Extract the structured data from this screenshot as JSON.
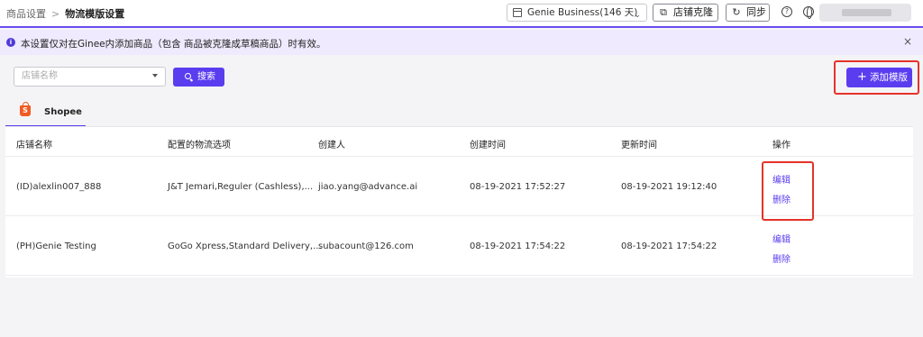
{
  "breadcrumb": {
    "parent": "商品设置",
    "separator": ">",
    "current": "物流模版设置"
  },
  "header": {
    "store_select": "Genie Business(146 天)",
    "clone_button": "店铺克隆",
    "sync_button": "同步",
    "help_icon": "question-circle-icon",
    "language_icon": "globe-icon"
  },
  "notice": {
    "text": "本设置仅对在Ginee内添加商品（包含 商品被克隆成草稿商品）时有效。",
    "icon": "info-icon",
    "close": "×"
  },
  "filters": {
    "shop_placeholder": "店铺名称",
    "search_button": "搜索"
  },
  "add_template_button": "添加模版",
  "tabs": [
    {
      "label": "Shopee",
      "icon": "shopee-bag-icon"
    }
  ],
  "table": {
    "headers": [
      "店铺名称",
      "配置的物流选项",
      "创建人",
      "创建时间",
      "更新时间",
      "操作"
    ],
    "rows": [
      {
        "shop": "(ID)alexlin007_888",
        "logistics": "J&T Jemari,Reguler (Cashless),...",
        "creator": "jiao.yang@advance.ai",
        "created": "08-19-2021 17:52:27",
        "updated": "08-19-2021 19:12:40",
        "edit": "编辑",
        "delete": "删除"
      },
      {
        "shop": "(PH)Genie Testing",
        "logistics": "GoGo Xpress,Standard Delivery,...",
        "creator": "subacount@126.com",
        "created": "08-19-2021 17:54:22",
        "updated": "08-19-2021 17:54:22",
        "edit": "编辑",
        "delete": "删除"
      }
    ]
  },
  "colors": {
    "accent": "#5b3df0",
    "highlight": "#e5322a",
    "notice_bg": "#efeafd"
  }
}
